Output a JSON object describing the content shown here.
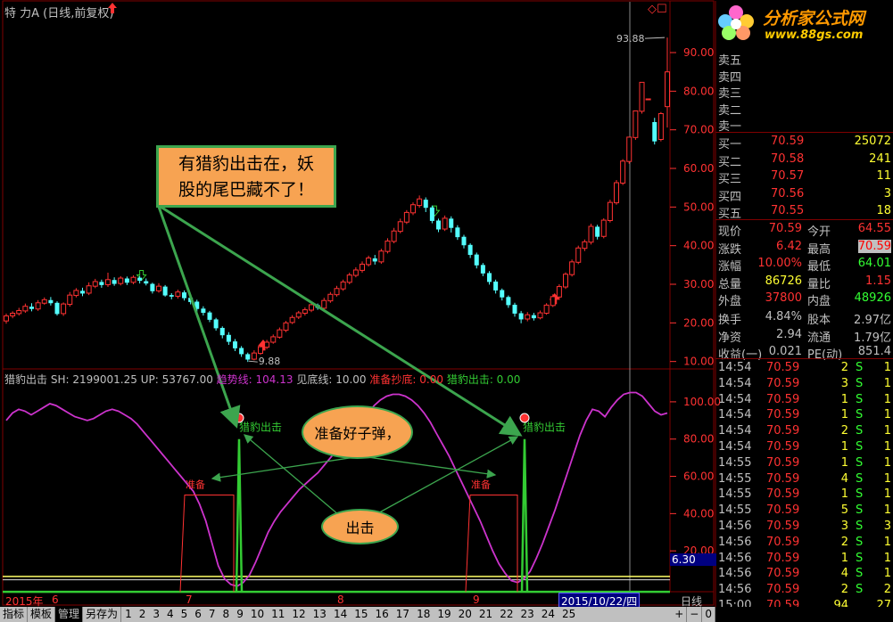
{
  "window": {
    "title": "特 力A (日线,前复权)",
    "top_right_icons": "◇☐"
  },
  "colors": {
    "bg": "#000000",
    "up": "#ff3232",
    "down": "#54ffff",
    "grid": "#800000",
    "axis": "#ff3232",
    "green": "#33cc33",
    "magenta": "#cc33cc",
    "callout_fill": "#f7a352",
    "callout_border": "#3ca54e",
    "ellipse_fill": "#f7a352"
  },
  "chart_data": [
    {
      "type": "candlestick",
      "ylim": [
        9,
        99
      ],
      "y_ticks": [
        "90.00",
        "80.00",
        "70.00",
        "60.00",
        "50.00",
        "40.00",
        "30.00",
        "20.00",
        "10.00"
      ],
      "y_tick_values": [
        90,
        80,
        70,
        60,
        50,
        40,
        30,
        20,
        10
      ],
      "annotations": {
        "high_label": "93.88",
        "low_label": "9.88"
      },
      "candles": [
        [
          20.5,
          21.8,
          19.8,
          22.4
        ],
        [
          21.8,
          22.5,
          21.2,
          23.0
        ],
        [
          22.4,
          23.2,
          21.9,
          23.9
        ],
        [
          23.1,
          24.3,
          22.6,
          25.0
        ],
        [
          24.2,
          23.6,
          23.0,
          25.1
        ],
        [
          23.6,
          25.2,
          23.1,
          25.9
        ],
        [
          25.1,
          26.0,
          24.7,
          26.6
        ],
        [
          25.9,
          25.1,
          24.5,
          26.7
        ],
        [
          25.2,
          22.3,
          21.9,
          25.6
        ],
        [
          22.4,
          24.9,
          21.8,
          25.3
        ],
        [
          24.8,
          27.2,
          24.2,
          28.0
        ],
        [
          27.1,
          28.4,
          26.6,
          29.0
        ],
        [
          28.3,
          27.6,
          26.9,
          29.1
        ],
        [
          27.7,
          29.6,
          27.2,
          30.5
        ],
        [
          29.5,
          30.7,
          29.0,
          31.4
        ],
        [
          30.6,
          29.8,
          29.1,
          31.2
        ],
        [
          29.9,
          31.2,
          29.3,
          33.0
        ],
        [
          31.1,
          30.1,
          29.6,
          31.8
        ],
        [
          30.2,
          31.6,
          29.7,
          32.1
        ],
        [
          31.5,
          30.4,
          29.8,
          32.0
        ],
        [
          30.5,
          31.8,
          30.0,
          32.3
        ],
        [
          31.7,
          30.9,
          30.2,
          32.2
        ],
        [
          30.8,
          30.2,
          29.7,
          31.5
        ],
        [
          30.1,
          28.2,
          27.6,
          30.4
        ],
        [
          28.3,
          29.5,
          27.8,
          30.3
        ],
        [
          29.4,
          27.1,
          26.8,
          29.8
        ],
        [
          27.2,
          26.8,
          26.1,
          27.7
        ],
        [
          26.9,
          28.0,
          26.3,
          28.6
        ],
        [
          27.9,
          26.4,
          25.8,
          28.4
        ],
        [
          26.5,
          25.4,
          24.8,
          27.0
        ],
        [
          25.5,
          23.6,
          22.9,
          26.0
        ],
        [
          23.7,
          22.6,
          21.9,
          24.3
        ],
        [
          22.7,
          20.8,
          20.2,
          23.1
        ],
        [
          20.9,
          18.6,
          18.0,
          21.3
        ],
        [
          18.7,
          16.8,
          16.0,
          19.1
        ],
        [
          16.9,
          15.1,
          14.3,
          17.6
        ],
        [
          15.2,
          13.4,
          12.7,
          15.8
        ],
        [
          13.5,
          11.9,
          11.2,
          14.0
        ],
        [
          11.9,
          10.5,
          9.88,
          12.3
        ],
        [
          10.6,
          12.2,
          10.3,
          12.9
        ],
        [
          12.1,
          13.8,
          11.7,
          14.4
        ],
        [
          13.7,
          15.0,
          13.2,
          15.6
        ],
        [
          15.0,
          16.4,
          14.6,
          17.0
        ],
        [
          16.3,
          18.2,
          15.9,
          18.8
        ],
        [
          18.1,
          20.0,
          17.6,
          20.5
        ],
        [
          20.1,
          21.4,
          19.7,
          22.0
        ],
        [
          21.5,
          22.6,
          21.0,
          23.1
        ],
        [
          22.5,
          23.4,
          21.9,
          24.0
        ],
        [
          23.3,
          24.7,
          22.8,
          25.3
        ],
        [
          24.6,
          23.9,
          23.4,
          25.0
        ],
        [
          23.8,
          25.8,
          23.2,
          26.5
        ],
        [
          25.7,
          27.4,
          25.2,
          28.0
        ],
        [
          27.3,
          28.9,
          26.8,
          29.6
        ],
        [
          28.8,
          30.6,
          28.3,
          31.2
        ],
        [
          30.5,
          32.4,
          30.0,
          33.0
        ],
        [
          32.3,
          33.7,
          31.8,
          34.4
        ],
        [
          33.6,
          35.2,
          33.0,
          35.9
        ],
        [
          35.1,
          36.8,
          34.6,
          37.4
        ],
        [
          36.7,
          35.9,
          35.1,
          37.6
        ],
        [
          35.8,
          38.6,
          35.3,
          39.2
        ],
        [
          38.5,
          41.2,
          38.0,
          41.9
        ],
        [
          41.1,
          43.8,
          40.6,
          44.6
        ],
        [
          43.7,
          46.2,
          43.2,
          47.0
        ],
        [
          46.1,
          48.6,
          45.6,
          49.2
        ],
        [
          48.5,
          50.6,
          47.9,
          51.2
        ],
        [
          50.4,
          52.1,
          49.8,
          53.0
        ],
        [
          51.9,
          49.8,
          48.7,
          52.5
        ],
        [
          49.9,
          46.4,
          45.8,
          50.4
        ],
        [
          46.5,
          44.2,
          43.5,
          47.0
        ],
        [
          44.3,
          47.1,
          43.8,
          47.8
        ],
        [
          47.0,
          44.6,
          43.4,
          47.6
        ],
        [
          44.7,
          42.2,
          41.5,
          45.3
        ],
        [
          42.3,
          40.1,
          39.3,
          42.8
        ],
        [
          40.2,
          37.6,
          36.8,
          40.6
        ],
        [
          37.7,
          34.9,
          34.1,
          38.2
        ],
        [
          35.0,
          32.8,
          32.1,
          35.5
        ],
        [
          32.9,
          30.6,
          29.9,
          33.4
        ],
        [
          30.7,
          28.4,
          27.6,
          31.2
        ],
        [
          28.5,
          26.6,
          25.8,
          28.9
        ],
        [
          26.7,
          24.6,
          23.9,
          27.1
        ],
        [
          24.7,
          22.4,
          21.6,
          25.2
        ],
        [
          22.5,
          20.9,
          19.9,
          23.1
        ],
        [
          21.0,
          22.1,
          20.4,
          22.8
        ],
        [
          22.0,
          21.2,
          20.6,
          22.6
        ],
        [
          21.3,
          22.6,
          20.9,
          23.2
        ],
        [
          22.5,
          24.6,
          22.1,
          25.1
        ],
        [
          24.5,
          26.8,
          24.1,
          27.4
        ],
        [
          26.7,
          29.4,
          26.2,
          30.0
        ],
        [
          29.3,
          32.6,
          28.8,
          33.1
        ],
        [
          32.5,
          35.8,
          32.0,
          36.4
        ],
        [
          35.7,
          39.4,
          35.2,
          40.0
        ],
        [
          39.3,
          41.0,
          38.6,
          41.6
        ],
        [
          40.9,
          45.0,
          40.3,
          45.7
        ],
        [
          44.9,
          42.3,
          41.6,
          45.4
        ],
        [
          42.4,
          46.6,
          41.9,
          47.1
        ],
        [
          46.5,
          51.2,
          46.0,
          51.9
        ],
        [
          51.1,
          56.3,
          50.6,
          57.0
        ],
        [
          56.2,
          61.9,
          55.7,
          62.4
        ],
        [
          61.8,
          68.1,
          61.2,
          68.1
        ],
        [
          68.0,
          74.9,
          67.4,
          74.9
        ],
        [
          74.8,
          82.3,
          74.2,
          82.3
        ],
        [
          78.0,
          78.0,
          78.0,
          78.0
        ],
        [
          72.0,
          67.0,
          66.2,
          73.1
        ],
        [
          67.5,
          74.2,
          67.0,
          74.6
        ],
        [
          76.0,
          85.0,
          70.59,
          93.88
        ]
      ]
    },
    {
      "type": "line",
      "ylim": [
        0,
        110
      ],
      "y_ticks": [
        "100.00",
        "80.00",
        "60.00",
        "40.00",
        "20.00"
      ],
      "y_tick_values": [
        100,
        80,
        60,
        40,
        20
      ],
      "series_name": "趋势线",
      "values": [
        90,
        94,
        96,
        95,
        93,
        95,
        97,
        99,
        98,
        96,
        94,
        92,
        91,
        90,
        91,
        93,
        95,
        96,
        95,
        93,
        91,
        88,
        84,
        80,
        76,
        72,
        68,
        64,
        60,
        56,
        52,
        45,
        36,
        24,
        12,
        5,
        2,
        1,
        3,
        7,
        14,
        22,
        30,
        36,
        41,
        45,
        49,
        53,
        56,
        59,
        62,
        66,
        70,
        74,
        78,
        82,
        86,
        90,
        94,
        98,
        101,
        103,
        104,
        104,
        103,
        101,
        98,
        94,
        89,
        83,
        77,
        71,
        64,
        57,
        50,
        43,
        36,
        28,
        20,
        13,
        8,
        4,
        3,
        5,
        9,
        16,
        24,
        33,
        42,
        52,
        62,
        72,
        82,
        90,
        96,
        95,
        92,
        97,
        101,
        104,
        105,
        105,
        103,
        99,
        95,
        93,
        94
      ]
    }
  ],
  "indicator_panel": {
    "name": "猎豹出击",
    "sh": "SH: 2199001.25",
    "up": "UP: 53767.00",
    "trend": "趋势线: 104.13",
    "bottom": "见底线: 10.00",
    "ready": "准备抄底: 0.00",
    "attack": "猎豹出击: 0.00",
    "label_ready": "准备",
    "label_attack": "猎豹出击",
    "right_value": "6.30"
  },
  "annotations": {
    "callout_text_1": "有猎豹出击在，妖",
    "callout_text_2": "股的尾巴藏不了！",
    "ellipse_1": "准备好子弹，",
    "ellipse_2": "出击"
  },
  "x_axis": {
    "year_label": "2015年",
    "months": [
      "6",
      "7",
      "8",
      "9"
    ],
    "date_box": "2015/10/22/四",
    "period": "日线"
  },
  "order_book": {
    "sell_labels": [
      "卖五",
      "卖四",
      "卖三",
      "卖二",
      "卖一"
    ],
    "buy_labels": [
      "买一",
      "买二",
      "买三",
      "买四",
      "买五"
    ],
    "buy_prices": [
      "70.59",
      "70.58",
      "70.57",
      "70.56",
      "70.55"
    ],
    "buy_vols": [
      "25072",
      "241",
      "11",
      "3",
      "18"
    ]
  },
  "quote": {
    "rows": [
      {
        "l1": "现价",
        "v1": "70.59",
        "l2": "今开",
        "v2": "64.55"
      },
      {
        "l1": "涨跌",
        "v1": "6.42",
        "l2": "最高",
        "v2": "70.59"
      },
      {
        "l1": "涨幅",
        "v1": "10.00%",
        "l2": "最低",
        "v2": "64.01"
      },
      {
        "l1": "总量",
        "v1": "86726",
        "l2": "量比",
        "v2": "1.15"
      },
      {
        "l1": "外盘",
        "v1": "37800",
        "l2": "内盘",
        "v2": "48926"
      },
      {
        "l1": "换手",
        "v1": "4.84%",
        "l2": "股本",
        "v2": "2.97亿"
      },
      {
        "l1": "净资",
        "v1": "2.94",
        "l2": "流通",
        "v2": "1.79亿"
      },
      {
        "l1": "收益(一)",
        "v1": "0.021",
        "l2": "PE(动)",
        "v2": "851.4"
      }
    ]
  },
  "ticks": [
    {
      "t": "14:54",
      "p": "70.59",
      "v": "2",
      "s": "S",
      "n": "1"
    },
    {
      "t": "14:54",
      "p": "70.59",
      "v": "3",
      "s": "S",
      "n": "1"
    },
    {
      "t": "14:54",
      "p": "70.59",
      "v": "1",
      "s": "S",
      "n": "1"
    },
    {
      "t": "14:54",
      "p": "70.59",
      "v": "1",
      "s": "S",
      "n": "1"
    },
    {
      "t": "14:54",
      "p": "70.59",
      "v": "2",
      "s": "S",
      "n": "1"
    },
    {
      "t": "14:54",
      "p": "70.59",
      "v": "1",
      "s": "S",
      "n": "1"
    },
    {
      "t": "14:55",
      "p": "70.59",
      "v": "1",
      "s": "S",
      "n": "1"
    },
    {
      "t": "14:55",
      "p": "70.59",
      "v": "4",
      "s": "S",
      "n": "1"
    },
    {
      "t": "14:55",
      "p": "70.59",
      "v": "1",
      "s": "S",
      "n": "1"
    },
    {
      "t": "14:55",
      "p": "70.59",
      "v": "5",
      "s": "S",
      "n": "1"
    },
    {
      "t": "14:56",
      "p": "70.59",
      "v": "3",
      "s": "S",
      "n": "3"
    },
    {
      "t": "14:56",
      "p": "70.59",
      "v": "2",
      "s": "S",
      "n": "1"
    },
    {
      "t": "14:56",
      "p": "70.59",
      "v": "1",
      "s": "S",
      "n": "1"
    },
    {
      "t": "14:56",
      "p": "70.59",
      "v": "4",
      "s": "S",
      "n": "1"
    },
    {
      "t": "14:56",
      "p": "70.59",
      "v": "2",
      "s": "S",
      "n": "2"
    },
    {
      "t": "15:00",
      "p": "70.59",
      "v": "94",
      "s": "",
      "n": "27"
    }
  ],
  "toolbar": {
    "tabs": [
      "指标",
      "模板",
      "管理",
      "另存为"
    ],
    "active": 2,
    "numbers": [
      "1",
      "2",
      "3",
      "4",
      "5",
      "6",
      "7",
      "8",
      "9",
      "10",
      "11",
      "12",
      "13",
      "14",
      "15",
      "16",
      "17",
      "18",
      "19",
      "20",
      "21",
      "22",
      "23",
      "24",
      "25"
    ],
    "right_buttons": [
      "+",
      "−",
      "0"
    ]
  },
  "logo": {
    "brand": "分析家公式网",
    "url": "www.88gs.com"
  }
}
